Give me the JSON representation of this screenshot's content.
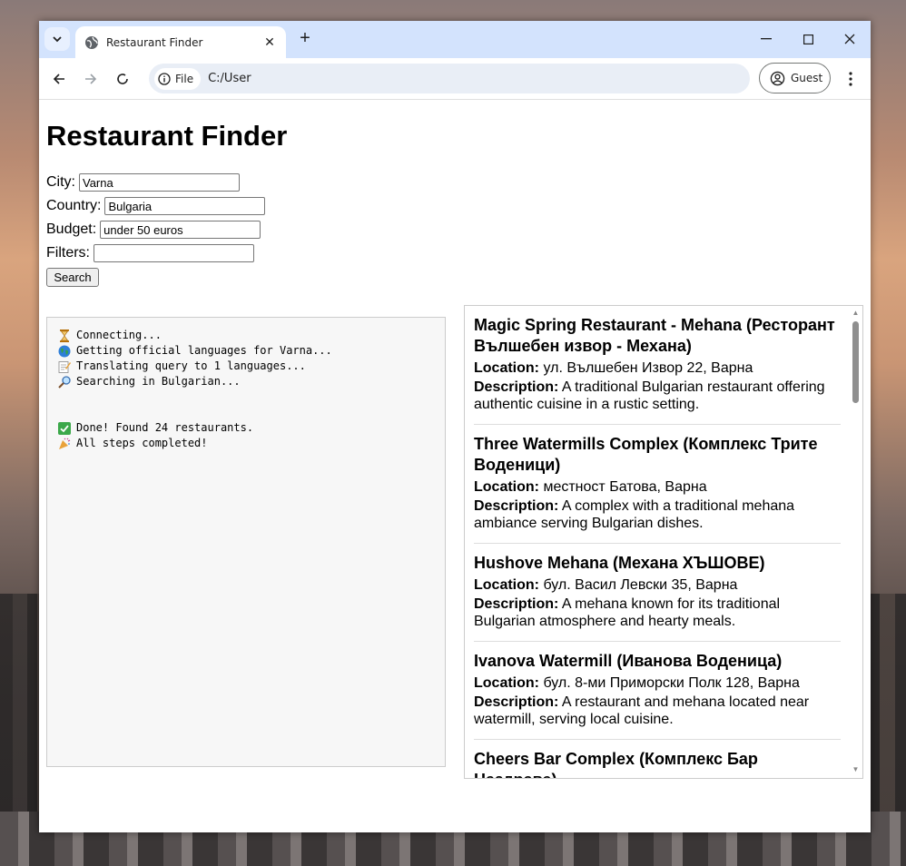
{
  "browser": {
    "tab_title": "Restaurant Finder",
    "new_tab": "+",
    "address_chip": "File",
    "url": "C:/User",
    "profile_label": "Guest"
  },
  "page": {
    "title": "Restaurant Finder",
    "form": {
      "city_label": "City:",
      "city_value": "Varna",
      "country_label": "Country:",
      "country_value": "Bulgaria",
      "budget_label": "Budget:",
      "budget_value": "under 50 euros",
      "filters_label": "Filters:",
      "filters_value": "",
      "search_button": "Search"
    },
    "log": [
      {
        "icon": "hourglass-icon",
        "text": "Connecting..."
      },
      {
        "icon": "globe-icon",
        "text": "Getting official languages for Varna..."
      },
      {
        "icon": "memo-icon",
        "text": "Translating query to 1 languages..."
      },
      {
        "icon": "magnifier-icon",
        "text": "Searching in Bulgarian..."
      },
      {
        "icon": "",
        "text": ""
      },
      {
        "icon": "",
        "text": ""
      },
      {
        "icon": "checkmark-icon",
        "text": "Done! Found 24 restaurants."
      },
      {
        "icon": "party-popper-icon",
        "text": "All steps completed!"
      }
    ],
    "results": {
      "location_label": "Location:",
      "description_label": "Description:",
      "items": [
        {
          "name": "Magic Spring Restaurant - Mehana (Ресторант Вълшебен извор - Механа)",
          "location": "ул. Вълшебен Извор 22, Варна",
          "description": "A traditional Bulgarian restaurant offering authentic cuisine in a rustic setting."
        },
        {
          "name": "Three Watermills Complex (Комплекс Трите Воденици)",
          "location": "местност Батова, Варна",
          "description": "A complex with a traditional mehana ambiance serving Bulgarian dishes."
        },
        {
          "name": "Hushove Mehana (Механа ХЪШОВЕ)",
          "location": "бул. Васил Левски 35, Варна",
          "description": "A mehana known for its traditional Bulgarian atmosphere and hearty meals."
        },
        {
          "name": "Ivanova Watermill (Иванова Воденица)",
          "location": "бул. 8-ми Приморски Полк 128, Варна",
          "description": "A restaurant and mehana located near watermill, serving local cuisine."
        },
        {
          "name": "Cheers Bar Complex (Комплекс Бар Наздраве)",
          "location": "",
          "description": ""
        }
      ]
    }
  }
}
